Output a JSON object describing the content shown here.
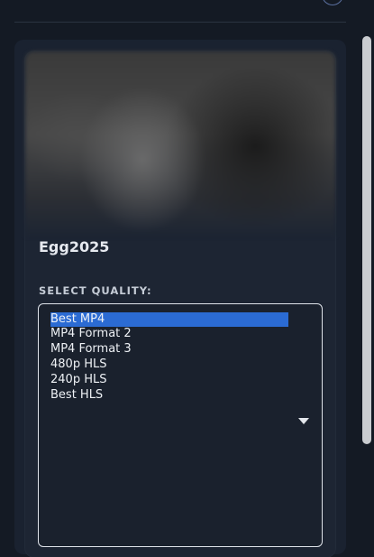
{
  "video": {
    "title": "Egg2025"
  },
  "quality": {
    "label": "SELECT QUALITY:",
    "selected": "Best MP4",
    "options": [
      "Best MP4",
      "MP4 Format 2",
      "MP4 Format 3",
      "480p HLS",
      "240p HLS",
      "Best HLS"
    ]
  },
  "colors": {
    "background": "#141a24",
    "card": "#1d2533",
    "selection": "#2b6bd3",
    "text": "#e6e9ef"
  },
  "icons": {
    "dropdown": "chevron-down-icon",
    "header_button": "circle-button-icon"
  }
}
